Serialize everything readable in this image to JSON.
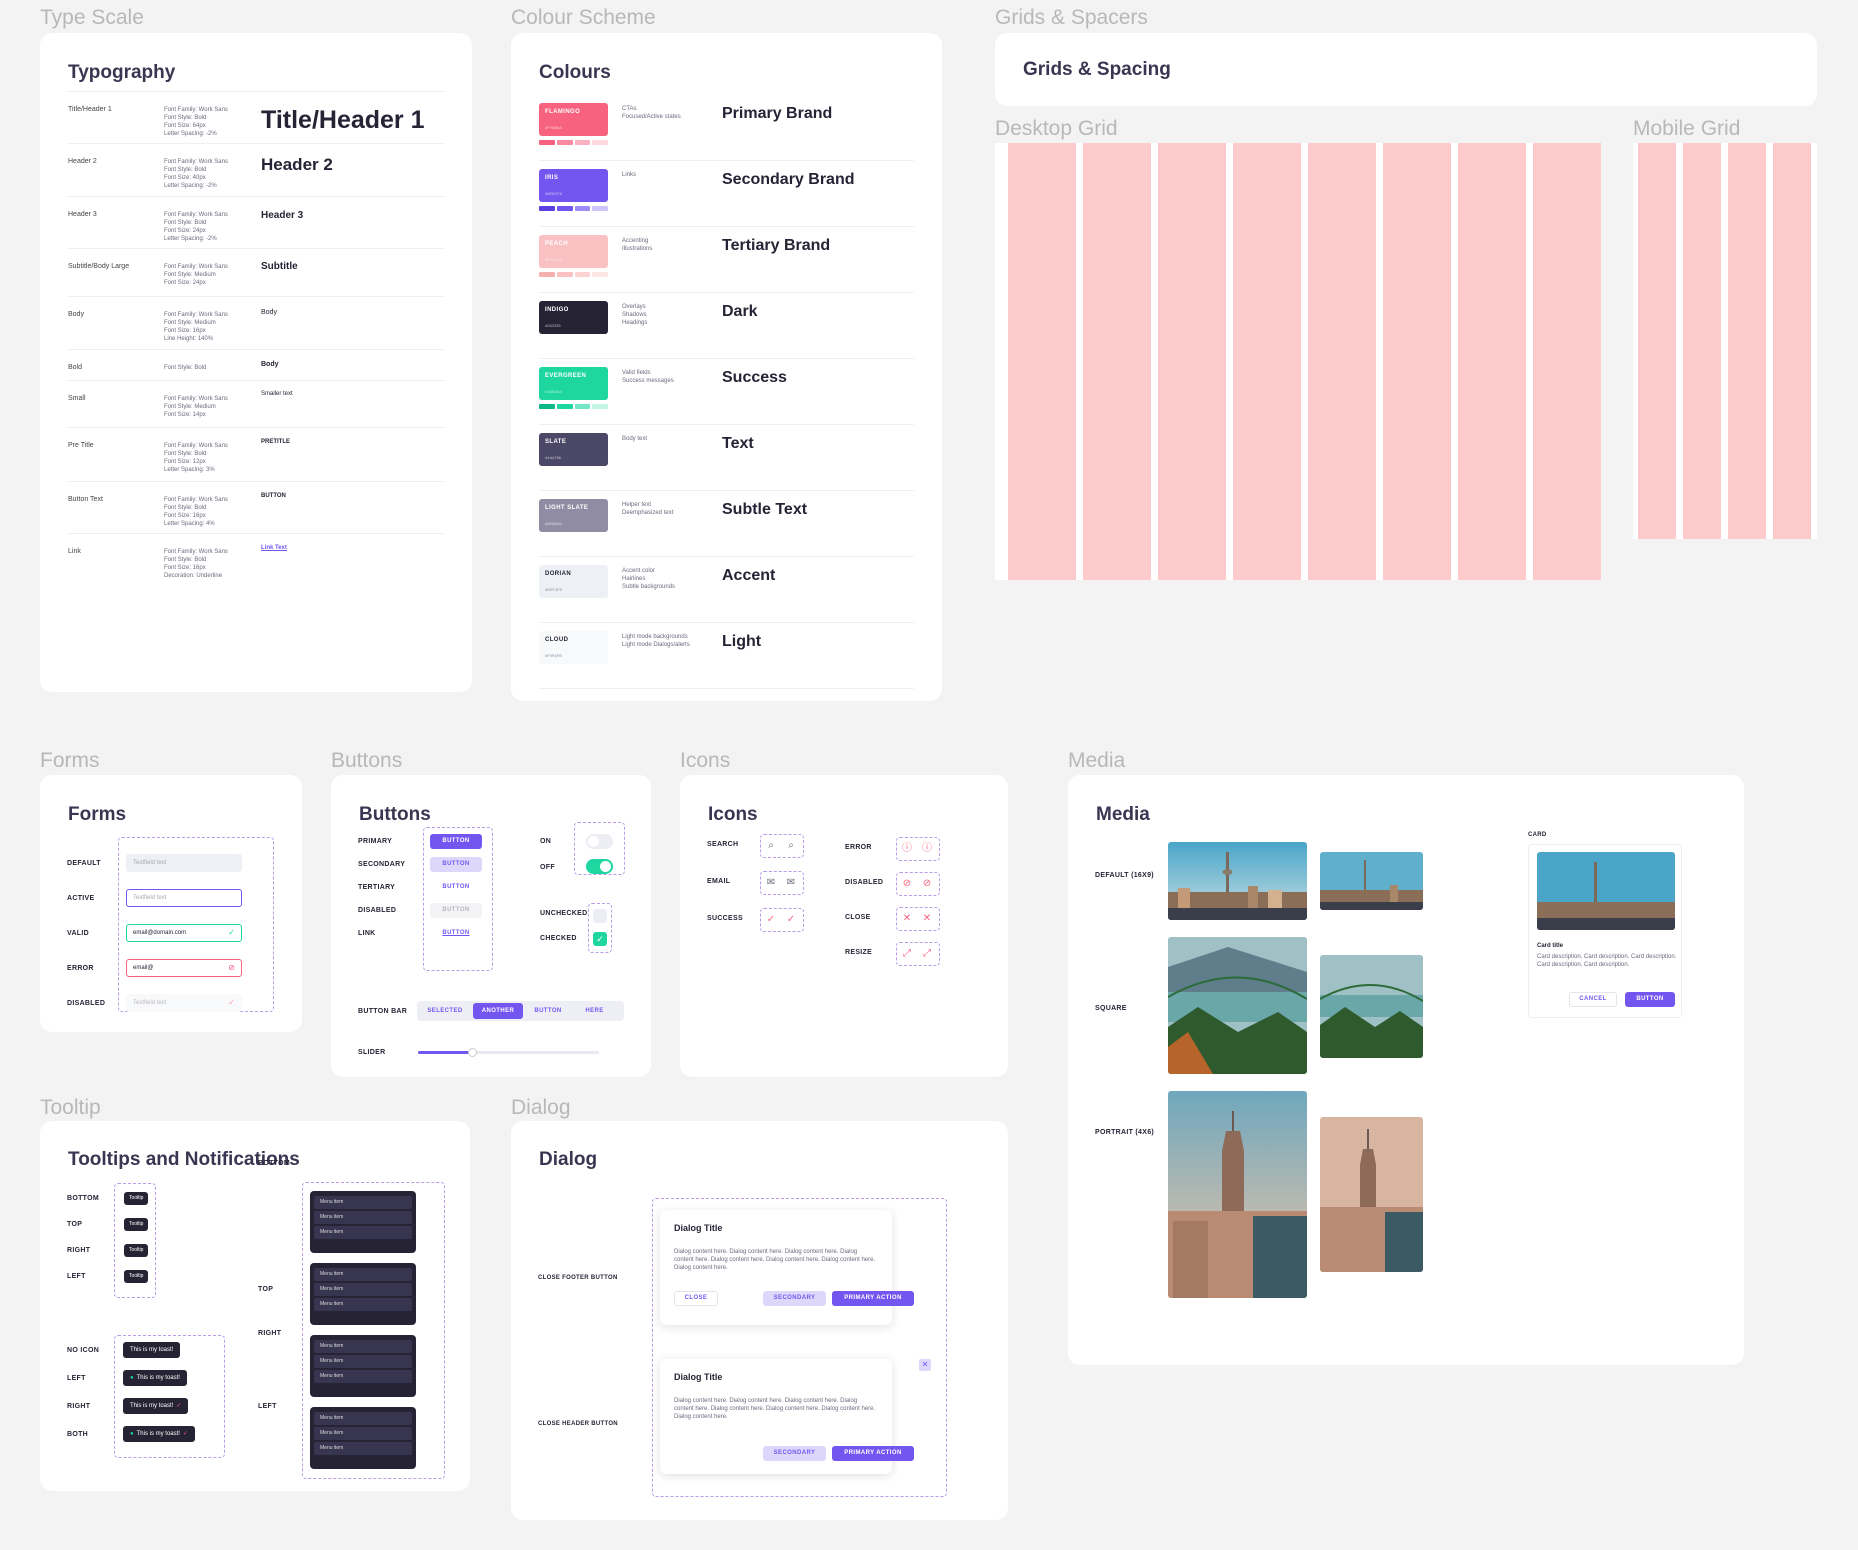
{
  "sections": {
    "type_scale": "Type Scale",
    "colour_scheme": "Colour Scheme",
    "grids": "Grids & Spacers",
    "forms": "Forms",
    "buttons": "Buttons",
    "icons": "Icons",
    "media": "Media",
    "tooltip": "Tooltip",
    "dialog": "Dialog"
  },
  "typography": {
    "title": "Typography",
    "rows": [
      {
        "name": "Title/Header 1",
        "spec": [
          "Font Family: Work Sans",
          "Font Style: Bold",
          "Font Size: 64px",
          "Letter Spacing: -2%"
        ],
        "sample": "Title/Header 1"
      },
      {
        "name": "Header 2",
        "spec": [
          "Font Family: Work Sans",
          "Font Style: Bold",
          "Font Size: 40px",
          "Letter Spacing: -2%"
        ],
        "sample": "Header 2"
      },
      {
        "name": "Header 3",
        "spec": [
          "Font Family: Work Sans",
          "Font Style: Bold",
          "Font Size: 24px",
          "Letter Spacing: -2%"
        ],
        "sample": "Header 3"
      },
      {
        "name": "Subtitle/Body Large",
        "spec": [
          "Font Family: Work Sans",
          "Font Style: Medium",
          "Font Size: 24px"
        ],
        "sample": "Subtitle"
      },
      {
        "name": "Body",
        "spec": [
          "Font Family: Work Sans",
          "Font Style: Medium",
          "Font Size: 16px",
          "Line Height: 140%"
        ],
        "sample": "Body"
      },
      {
        "name": "Bold",
        "spec": [
          "Font Style: Bold"
        ],
        "sample": "Body"
      },
      {
        "name": "Small",
        "spec": [
          "Font Family: Work Sans",
          "Font Style: Medium",
          "Font Size: 14px"
        ],
        "sample": "Smaller text"
      },
      {
        "name": "Pre Title",
        "spec": [
          "Font Family: Work Sans",
          "Font Style: Bold",
          "Font Size: 12px",
          "Letter Spacing: 3%"
        ],
        "sample": "PRETITLE"
      },
      {
        "name": "Button Text",
        "spec": [
          "Font Family: Work Sans",
          "Font Style: Bold",
          "Font Size: 16px",
          "Letter Spacing: 4%"
        ],
        "sample": "BUTTON"
      },
      {
        "name": "Link",
        "spec": [
          "Font Family: Work Sans",
          "Font Style: Bold",
          "Font Size: 16px",
          "Decoration: Underline"
        ],
        "sample": "Link Text"
      }
    ]
  },
  "colours": {
    "title": "Colours",
    "rows": [
      {
        "swatch": "FLAMINGO",
        "hex": "#FF6B8A",
        "color": "#f7627f",
        "desc": [
          "CTAs",
          "Focused/Active states"
        ],
        "name": "Primary Brand",
        "bar": [
          "#f7627f",
          "#f98aa0",
          "#fbb1c0",
          "#fdd8df"
        ]
      },
      {
        "swatch": "IRIS",
        "hex": "#6E5CF6",
        "color": "#7356f0",
        "desc": [
          "Links"
        ],
        "name": "Secondary Brand",
        "bar": [
          "#5a40e0",
          "#7356f0",
          "#9d8cf5",
          "#cfc5fa"
        ]
      },
      {
        "swatch": "PEACH",
        "hex": "#FFC2C2",
        "color": "#f9c1c1",
        "desc": [
          "Accenting",
          "Illustrations"
        ],
        "name": "Tertiary Brand",
        "bar": [
          "#f7b0b0",
          "#f9c1c1",
          "#fbd3d3",
          "#fde6e6"
        ]
      },
      {
        "swatch": "INDIGO",
        "hex": "#262335",
        "color": "#262335",
        "desc": [
          "Overlays",
          "Shadows",
          "Headings"
        ],
        "name": "Dark",
        "bar": []
      },
      {
        "swatch": "EVERGREEN",
        "hex": "#16D6A4",
        "color": "#1ed6a0",
        "desc": [
          "Valid fields",
          "Success messages"
        ],
        "name": "Success",
        "bar": [
          "#0fb888",
          "#1ed6a0",
          "#72e6c5",
          "#c3f4e6"
        ]
      },
      {
        "swatch": "SLATE",
        "hex": "#4A4766",
        "color": "#4b4766",
        "desc": [
          "Body text"
        ],
        "name": "Text",
        "bar": []
      },
      {
        "swatch": "LIGHT SLATE",
        "hex": "#8E8BA0",
        "color": "#8f8ca3",
        "desc": [
          "Helper text",
          "Deemphasized text"
        ],
        "name": "Subtle Text",
        "bar": []
      },
      {
        "swatch": "DORIAN",
        "hex": "#EEF1F5",
        "color": "#edf0f5",
        "desc": [
          "Accent color",
          "Hairlines",
          "Subtle backgrounds"
        ],
        "name": "Accent",
        "bar": []
      },
      {
        "swatch": "CLOUD",
        "hex": "#F9FAFB",
        "color": "#f8f9fb",
        "desc": [
          "Light mode backgrounds",
          "Light mode Dialogs/alerts"
        ],
        "name": "Light",
        "bar": []
      }
    ]
  },
  "grids": {
    "title": "Grids & Spacing",
    "desktop": "Desktop Grid",
    "mobile": "Mobile Grid",
    "desktop_cols": 8,
    "mobile_cols": 4
  },
  "forms": {
    "title": "Forms",
    "rows": [
      {
        "label": "DEFAULT",
        "value": "Textfield text",
        "state": "default"
      },
      {
        "label": "ACTIVE",
        "value": "Textfield text",
        "state": "active"
      },
      {
        "label": "VALID",
        "value": "email@domain.com",
        "state": "valid"
      },
      {
        "label": "ERROR",
        "value": "email@",
        "state": "error"
      },
      {
        "label": "DISABLED",
        "value": "Textfield text",
        "state": "disabled"
      }
    ]
  },
  "buttons": {
    "title": "Buttons",
    "rows": [
      {
        "label": "PRIMARY",
        "btn": "BUTTON"
      },
      {
        "label": "SECONDARY",
        "btn": "BUTTON"
      },
      {
        "label": "TERTIARY",
        "btn": "BUTTON"
      },
      {
        "label": "DISABLED",
        "btn": "BUTTON"
      },
      {
        "label": "LINK",
        "btn": "BUTTON"
      }
    ],
    "on": "ON",
    "off": "OFF",
    "unchecked": "UNCHECKED",
    "checked": "CHECKED",
    "bar_label": "BUTTON BAR",
    "bar": [
      "SELECTED",
      "ANOTHER",
      "BUTTON",
      "HERE"
    ],
    "slider_label": "SLIDER",
    "slider_value": 0.3
  },
  "icons": {
    "title": "Icons",
    "left": [
      {
        "label": "SEARCH",
        "icon": "search-icon"
      },
      {
        "label": "EMAIL",
        "icon": "mail-icon"
      },
      {
        "label": "SUCCESS",
        "icon": "check-icon"
      }
    ],
    "right": [
      {
        "label": "ERROR",
        "icon": "error-icon"
      },
      {
        "label": "DISABLED",
        "icon": "disabled-icon"
      },
      {
        "label": "CLOSE",
        "icon": "close-icon"
      },
      {
        "label": "RESIZE",
        "icon": "resize-icon"
      }
    ]
  },
  "media": {
    "title": "Media",
    "default": "DEFAULT (16X9)",
    "square": "SQUARE",
    "portrait": "PORTRAIT (4X6)",
    "card_label": "CARD",
    "card_title": "Card title",
    "card_desc": "Card description. Card description. Card description. Card description. Card description.",
    "cancel": "CANCEL",
    "button": "BUTTON"
  },
  "tooltips": {
    "title": "Tooltips and Notifications",
    "positions": [
      "BOTTOM",
      "TOP",
      "RIGHT",
      "LEFT"
    ],
    "tooltip": "Tooltip",
    "toast_labels": [
      "NO ICON",
      "LEFT",
      "RIGHT",
      "BOTH"
    ],
    "toast": "This is my toast!",
    "menu_labels": [
      "BOTTOM",
      "TOP",
      "RIGHT",
      "LEFT"
    ],
    "menu_item": "Menu item"
  },
  "dialog": {
    "title": "Dialog",
    "footer_label": "CLOSE FOOTER BUTTON",
    "header_label": "CLOSE HEADER BUTTON",
    "dlg_title": "Dialog Title",
    "dlg_content": "Dialog content here. Dialog content here. Dialog content here. Dialog content here. Dialog content here. Dialog content here. Dialog content here. Dialog content here.",
    "close": "CLOSE",
    "secondary": "SECONDARY",
    "primary": "PRIMARY ACTION"
  }
}
